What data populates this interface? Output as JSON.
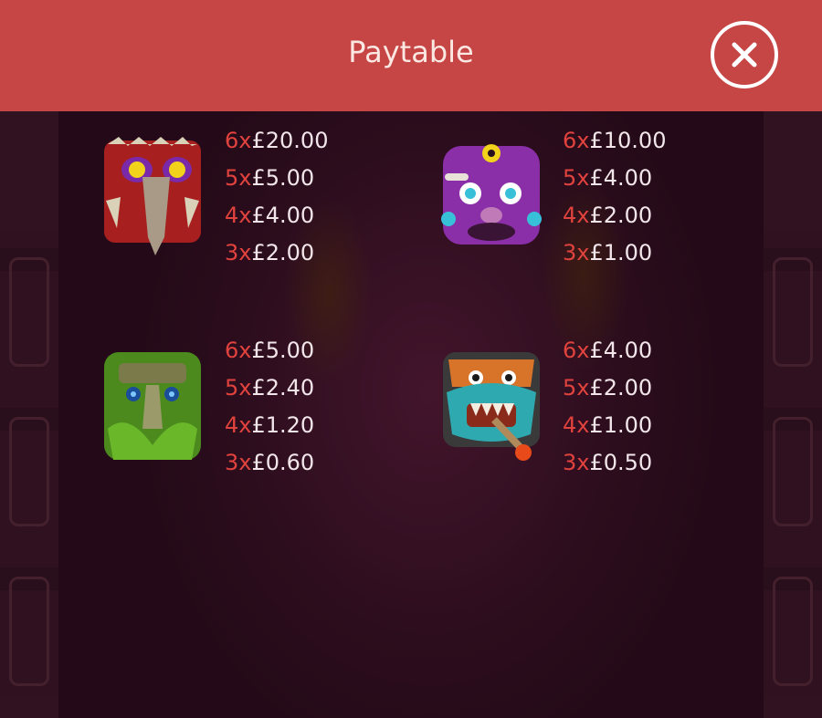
{
  "header": {
    "title": "Paytable",
    "close_icon": "close-icon",
    "color": "#c64545"
  },
  "colors": {
    "count_color": "#e0423d",
    "amount_color": "#f2e6ea",
    "background": "#2a0f1c"
  },
  "symbols": [
    {
      "icon": "red-bird-mask-icon",
      "payouts": [
        {
          "count": "6x",
          "amount": "£20.00"
        },
        {
          "count": "5x",
          "amount": "£5.00"
        },
        {
          "count": "4x",
          "amount": "£4.00"
        },
        {
          "count": "3x",
          "amount": "£2.00"
        }
      ]
    },
    {
      "icon": "purple-mask-icon",
      "payouts": [
        {
          "count": "6x",
          "amount": "£10.00"
        },
        {
          "count": "5x",
          "amount": "£4.00"
        },
        {
          "count": "4x",
          "amount": "£2.00"
        },
        {
          "count": "3x",
          "amount": "£1.00"
        }
      ]
    },
    {
      "icon": "green-leaf-mask-icon",
      "payouts": [
        {
          "count": "6x",
          "amount": "£5.00"
        },
        {
          "count": "5x",
          "amount": "£2.40"
        },
        {
          "count": "4x",
          "amount": "£1.20"
        },
        {
          "count": "3x",
          "amount": "£0.60"
        }
      ]
    },
    {
      "icon": "blue-beast-mask-icon",
      "payouts": [
        {
          "count": "6x",
          "amount": "£4.00"
        },
        {
          "count": "5x",
          "amount": "£2.00"
        },
        {
          "count": "4x",
          "amount": "£1.00"
        },
        {
          "count": "3x",
          "amount": "£0.50"
        }
      ]
    }
  ]
}
